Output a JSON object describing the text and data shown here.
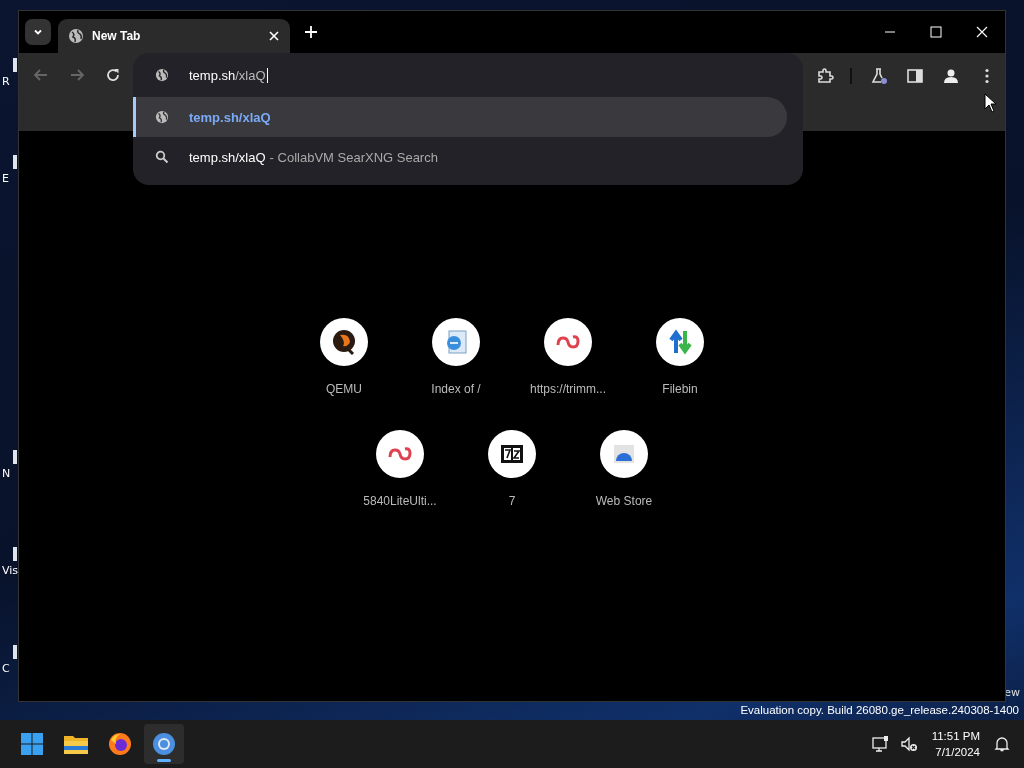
{
  "desktop_icons": [
    {
      "label": "R"
    },
    {
      "label": "E"
    },
    {
      "label": "N"
    },
    {
      "label": "Vis"
    },
    {
      "label": "C"
    }
  ],
  "desktop_edge_text": "ew",
  "browser": {
    "tab": {
      "title": "New Tab",
      "selected": true
    },
    "nav": {
      "back_disabled": true,
      "forward_disabled": true
    },
    "address": {
      "host": "temp.sh",
      "path": "/xlaQ"
    },
    "suggestions": [
      {
        "kind": "url",
        "text": "temp.sh/xlaQ",
        "selected": true
      },
      {
        "kind": "search",
        "text": "temp.sh/xlaQ",
        "detail": "- CollabVM SearXNG Search",
        "selected": false
      }
    ],
    "shortcuts": [
      {
        "title": "QEMU",
        "kind": "qemu"
      },
      {
        "title": "Index of /",
        "kind": "page"
      },
      {
        "title": "https://trimm...",
        "kind": "loop"
      },
      {
        "title": "Filebin",
        "kind": "updown"
      },
      {
        "title": "5840LiteUlti...",
        "kind": "loop"
      },
      {
        "title": "7",
        "kind": "archive"
      },
      {
        "title": "Web Store",
        "kind": "store"
      }
    ]
  },
  "watermark": "Evaluation copy. Build 26080.ge_release.240308-1400",
  "taskbar": {
    "apps": [
      {
        "kind": "start",
        "selected": false
      },
      {
        "kind": "folder",
        "selected": false
      },
      {
        "kind": "firefox",
        "selected": false
      },
      {
        "kind": "chrome",
        "selected": true
      }
    ],
    "time": "11:51 PM",
    "date": "7/1/2024"
  }
}
